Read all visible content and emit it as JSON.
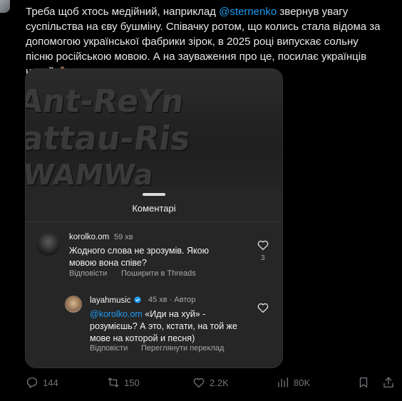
{
  "tweet": {
    "text_before": "Треба щоб хтось медійний, наприклад ",
    "mention": "@sternenko",
    "text_after": " звернув увагу суспільства на єву бушміну. Співачку ротом, що колись стала відома за допомогою української фабрики зірок, в 2025 році випускає сольну пісню російською мовою. А на зауваження про це, посилає українців нахуй "
  },
  "media": {
    "background_words": [
      "Ant-ReYn",
      "attau-Ris",
      "WAMWa"
    ],
    "sheet_title": "Коментарі",
    "comments": [
      {
        "username": "korolko.om",
        "time": "59 хв",
        "body_line1": "Жодного слова не зрозумів. Якою",
        "body_line2": "мовою вона співе?",
        "likes": "3",
        "reply_label": "Відповісти",
        "share_label": "Поширити в Threads"
      },
      {
        "username": "layahmusic",
        "time": "45 хв",
        "author_tag": "· Автор",
        "mention": "@korolko.om",
        "body_line1_rest": " «Иди на хуй» -",
        "body_line2": "розумієшь? А это, кстати, на той же",
        "body_line3": "мове на которой и песня)",
        "reply_label": "Відповісти",
        "translate_label": "Переглянути переклад"
      }
    ]
  },
  "actions": {
    "replies": "144",
    "reposts": "150",
    "likes": "2.2K",
    "views": "80K"
  },
  "icons": {
    "reply": "reply-icon",
    "repost": "repost-icon",
    "like": "heart-icon",
    "views": "views-icon",
    "share": "share-icon"
  },
  "colors": {
    "accent": "#1d9bf0",
    "muted": "#71767b",
    "text": "#e7e9ea"
  }
}
